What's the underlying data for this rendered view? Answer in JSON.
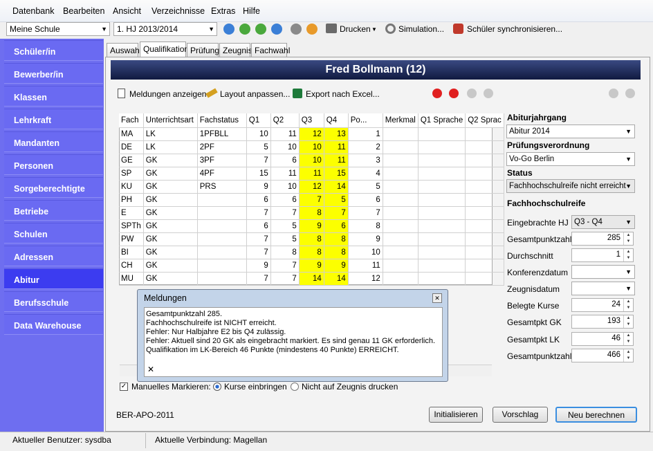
{
  "menu": [
    "Datenbank",
    "Bearbeiten",
    "Ansicht",
    "Verzeichnisse",
    "Extras",
    "Hilfe"
  ],
  "toolbar": {
    "school": "Meine Schule",
    "term": "1. HJ 2013/2014",
    "print": "Drucken",
    "simulation": "Simulation...",
    "sync": "Schüler synchronisieren..."
  },
  "sidebar": [
    "Schüler/in",
    "Bewerber/in",
    "Klassen",
    "Lehrkraft",
    "Mandanten",
    "Personen",
    "Sorgeberechtigte",
    "Betriebe",
    "Schulen",
    "Adressen",
    "Abitur",
    "Berufsschule",
    "Data Warehouse"
  ],
  "tabs": [
    "Auswahl",
    "Qualifikation",
    "Prüfung",
    "Zeugnis",
    "Fachwahl"
  ],
  "student": "Fred Bollmann (12)",
  "actions": {
    "messages": "Meldungen anzeigen",
    "layout": "Layout anpassen...",
    "export": "Export nach Excel..."
  },
  "table": {
    "headers": [
      "Fach",
      "Unterrichtsart",
      "Fachstatus",
      "Q1",
      "Q2",
      "Q3",
      "Q4",
      "Po...",
      "Merkmal",
      "Q1 Sprache",
      "Q2 Sprac"
    ],
    "rows": [
      [
        "MA",
        "LK",
        "1PFBLL",
        "10",
        "11",
        "12",
        "13",
        "1"
      ],
      [
        "DE",
        "LK",
        "2PF",
        "5",
        "10",
        "10",
        "11",
        "2"
      ],
      [
        "GE",
        "GK",
        "3PF",
        "7",
        "6",
        "10",
        "11",
        "3"
      ],
      [
        "SP",
        "GK",
        "4PF",
        "15",
        "11",
        "11",
        "15",
        "4"
      ],
      [
        "KU",
        "GK",
        "PRS",
        "9",
        "10",
        "12",
        "14",
        "5"
      ],
      [
        "PH",
        "GK",
        "",
        "6",
        "6",
        "7",
        "5",
        "6"
      ],
      [
        "E",
        "GK",
        "",
        "7",
        "7",
        "8",
        "7",
        "7"
      ],
      [
        "SPTh",
        "GK",
        "",
        "6",
        "5",
        "9",
        "6",
        "8"
      ],
      [
        "PW",
        "GK",
        "",
        "7",
        "5",
        "8",
        "8",
        "9"
      ],
      [
        "BI",
        "GK",
        "",
        "7",
        "8",
        "8",
        "8",
        "10"
      ],
      [
        "CH",
        "GK",
        "",
        "9",
        "7",
        "9",
        "9",
        "11"
      ],
      [
        "MU",
        "GK",
        "",
        "7",
        "7",
        "14",
        "14",
        "12"
      ]
    ]
  },
  "dialog": {
    "title": "Meldungen",
    "lines": [
      "Gesamtpunktzahl 285.",
      "Fachhochschulreife ist NICHT erreicht.",
      "Fehler: Nur Halbjahre E2 bis Q4 zulässig.",
      "Fehler: Aktuell sind 20 GK als eingebracht markiert. Es sind genau 11 GK erforderlich.",
      "Qualifikation im LK-Bereich 46 Punkte (mindestens 40 Punkte) ERREICHT."
    ]
  },
  "options": {
    "manual": "Manuelles Markieren:",
    "radio1": "Kurse einbringen",
    "radio2": "Nicht auf Zeugnis drucken"
  },
  "right": {
    "abiturjahrgang_label": "Abiturjahrgang",
    "abiturjahrgang": "Abitur 2014",
    "pruefungsverordnung_label": "Prüfungsverordnung",
    "pruefungsverordnung": "Vo-Go Berlin",
    "status_label": "Status",
    "status": "Fachhochschulreife nicht erreicht",
    "fhr_label": "Fachhochschulreife",
    "fields": [
      {
        "label": "Eingebrachte HJ",
        "value": "Q3 - Q4"
      },
      {
        "label": "Gesamtpunktzahl",
        "value": "285"
      },
      {
        "label": "Durchschnitt",
        "value": "1"
      },
      {
        "label": "Konferenzdatum",
        "value": ""
      },
      {
        "label": "Zeugnisdatum",
        "value": ""
      },
      {
        "label": "Belegte Kurse",
        "value": "24"
      },
      {
        "label": "Gesamtpkt GK",
        "value": "193"
      },
      {
        "label": "Gesamtpkt LK",
        "value": "46"
      },
      {
        "label": "Gesamtpunktzahl",
        "value": "466"
      }
    ]
  },
  "footer": {
    "apo": "BER-APO-2011",
    "init": "Initialisieren",
    "suggest": "Vorschlag",
    "recalc": "Neu berechnen"
  },
  "status": {
    "user": "Aktueller Benutzer: sysdba",
    "connection": "Aktuelle Verbindung: Magellan"
  }
}
